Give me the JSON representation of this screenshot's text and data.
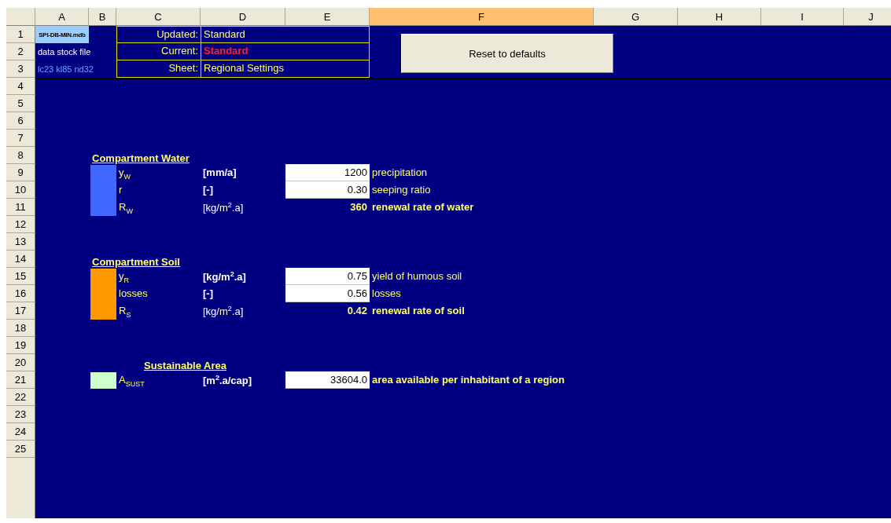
{
  "columns": [
    {
      "label": "A",
      "selected": false
    },
    {
      "label": "B",
      "selected": false
    },
    {
      "label": "C",
      "selected": false
    },
    {
      "label": "D",
      "selected": false
    },
    {
      "label": "E",
      "selected": false
    },
    {
      "label": "F",
      "selected": true
    },
    {
      "label": "G",
      "selected": false
    },
    {
      "label": "H",
      "selected": false
    },
    {
      "label": "I",
      "selected": false
    },
    {
      "label": "J",
      "selected": false
    }
  ],
  "row_numbers": [
    "1",
    "2",
    "3",
    "4",
    "5",
    "6",
    "7",
    "8",
    "9",
    "10",
    "11",
    "12",
    "13",
    "14",
    "15",
    "16",
    "17",
    "18",
    "19",
    "20",
    "21",
    "22",
    "23",
    "24",
    "25"
  ],
  "file_info": [
    "SPI-DB-MIN.mdb",
    "data stock file",
    "lc23 kl85 nd32"
  ],
  "status": [
    {
      "label": "Updated:",
      "value": "Standard",
      "emphasis": false
    },
    {
      "label": "Current:",
      "value": "Standard",
      "emphasis": true
    },
    {
      "label": "Sheet:",
      "value": "Regional Settings",
      "emphasis": false
    }
  ],
  "reset_button": "Reset to defaults",
  "sections": [
    {
      "title": "Compartment Water",
      "kind": "compartment",
      "color": "#4169ff",
      "rows": [
        {
          "kind": "input",
          "symbol": "y$_{W}$",
          "unit": "[mm/a]",
          "value": "1200",
          "description": "precipitation"
        },
        {
          "kind": "input",
          "symbol": "r",
          "unit": "[-]",
          "value": "0.30",
          "description": "seeping ratio"
        },
        {
          "kind": "result",
          "symbol": "R$_{W}$",
          "unit": "[kg/m$^{2}$.a]",
          "value": "360",
          "description": "renewal rate of water"
        }
      ]
    },
    {
      "title": "Compartment Soil",
      "kind": "compartment",
      "color": "#ff9900",
      "rows": [
        {
          "kind": "input",
          "symbol": "y$_{R}$",
          "unit": "[kg/m$^{2}$.a]",
          "value": "0.75",
          "description": "yield of humous soil"
        },
        {
          "kind": "input",
          "symbol": "losses",
          "unit": "[-]",
          "value": "0.56",
          "description": "losses"
        },
        {
          "kind": "result",
          "symbol": "R$_{S}$",
          "unit": "[kg/m$^{2}$.a]",
          "value": "0.42",
          "description": "renewal rate of soil"
        }
      ]
    },
    {
      "title": "Sustainable Area",
      "kind": "summary",
      "color": "#ccffcc",
      "rows": [
        {
          "kind": "highlight",
          "symbol": "A$_{SUST}$",
          "unit": "[m$^{2}$.a/cap]",
          "value": "33604.0",
          "description": "area available per inhabitant of a region"
        }
      ]
    }
  ]
}
